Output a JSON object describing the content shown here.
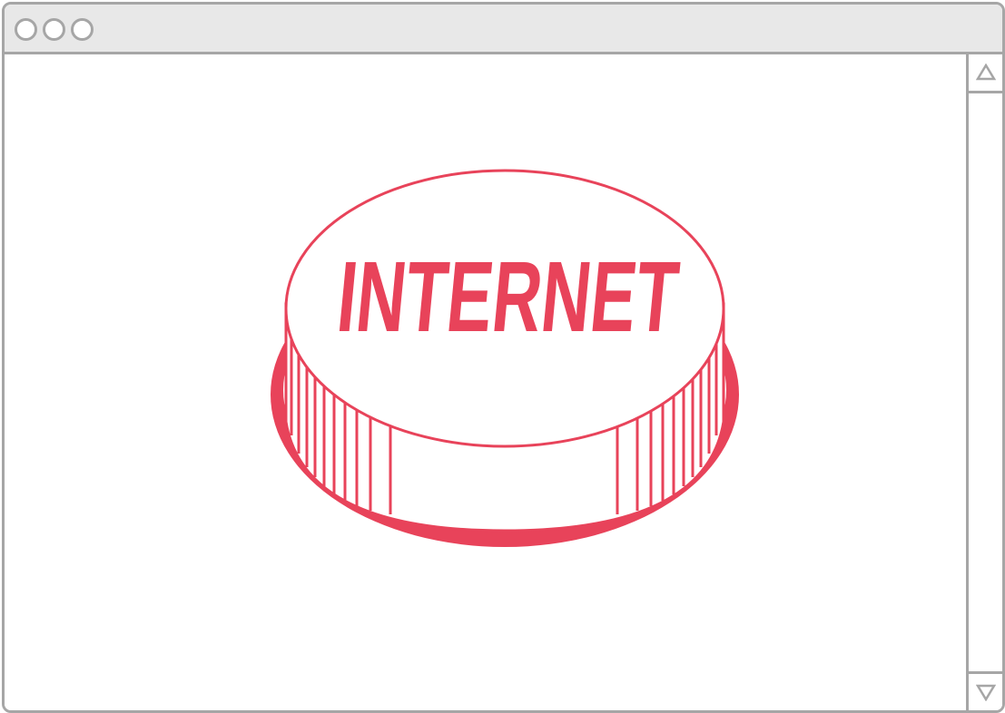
{
  "window": {
    "controls": [
      "close",
      "minimize",
      "maximize"
    ]
  },
  "main": {
    "button": {
      "label": "INTERNET",
      "color": "#e8435a"
    }
  },
  "scrollbar": {
    "up_icon": "triangle-up-icon",
    "down_icon": "triangle-down-icon"
  },
  "colors": {
    "frame": "#a6a6a6",
    "titlebar": "#e8e8e8",
    "accent": "#e8435a",
    "background": "#ffffff"
  }
}
